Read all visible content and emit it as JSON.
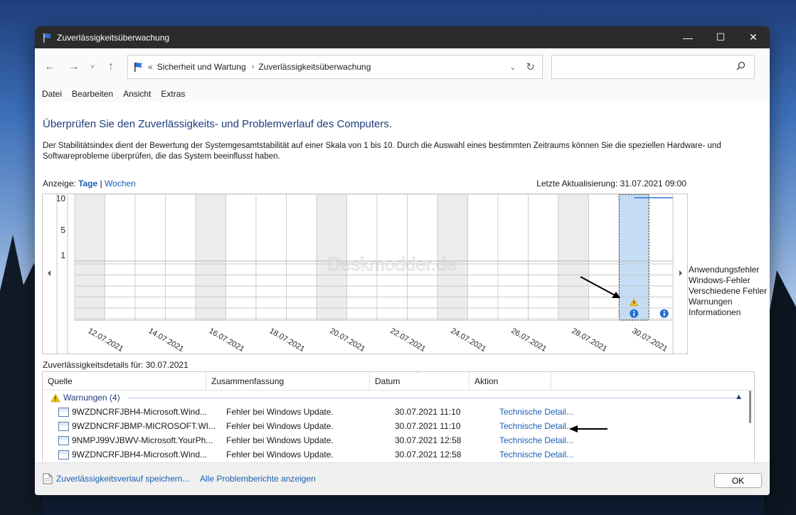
{
  "window": {
    "title": "Zuverlässigkeitsüberwachung"
  },
  "titlebar_controls": {
    "minimize": "—",
    "maximize": "☐",
    "close": "✕"
  },
  "nav": {
    "back": "←",
    "forward": "→",
    "recent": "˅",
    "up": "↑",
    "breadcrumb_prefix": "«",
    "breadcrumb": [
      "Sicherheit und Wartung",
      "Zuverlässigkeitsüberwachung"
    ],
    "breadcrumb_sep": "›",
    "search_placeholder": ""
  },
  "menu": [
    "Datei",
    "Bearbeiten",
    "Ansicht",
    "Extras"
  ],
  "heading": "Überprüfen Sie den Zuverlässigkeits- und Problemverlauf des Computers.",
  "description": "Der Stabilitätsindex dient der Bewertung der Systemgesamtstabilität auf einer Skala von 1 bis 10. Durch die Auswahl eines bestimmten Zeitraums können Sie die speziellen Hardware- und Softwareprobleme überprüfen, die das System beeinflusst haben.",
  "view": {
    "label": "Anzeige:",
    "days": "Tage",
    "separator": "|",
    "weeks": "Wochen"
  },
  "last_update": "Letzte Aktualisierung: 31.07.2021 09:00",
  "chart": {
    "y_ticks": [
      "10",
      "5",
      "1"
    ],
    "dates": [
      "12.07.2021",
      "14.07.2021",
      "16.07.2021",
      "18.07.2021",
      "20.07.2021",
      "22.07.2021",
      "24.07.2021",
      "26.07.2021",
      "28.07.2021",
      "30.07.2021"
    ],
    "days_count": 20,
    "selected_day_index": 18,
    "stability": [
      {
        "day_index": 18,
        "value": 10
      },
      {
        "day_index": 19,
        "value": 10
      }
    ],
    "events": [
      {
        "day_index": 18,
        "row": "Warnungen",
        "icon": "warning-icon"
      },
      {
        "day_index": 18,
        "row": "Informationen",
        "icon": "info-icon"
      },
      {
        "day_index": 19,
        "row": "Informationen",
        "icon": "info-icon"
      }
    ],
    "watermark": "Deskmodder.de",
    "legend": [
      "Anwendungsfehler",
      "Windows-Fehler",
      "Verschiedene Fehler",
      "Warnungen",
      "Informationen"
    ]
  },
  "details_label": "Zuverlässigkeitsdetails für: 30.07.2021",
  "table": {
    "columns": [
      "Quelle",
      "Zusammenfassung",
      "Datum",
      "Aktion"
    ],
    "group": {
      "label": "Warnungen (4)"
    },
    "rows": [
      {
        "source": "9WZDNCRFJBH4-Microsoft.Wind...",
        "summary": "Fehler bei Windows Update.",
        "date": "30.07.2021 11:10",
        "action": "Technische Detail..."
      },
      {
        "source": "9WZDNCRFJBMP-MICROSOFT.WI...",
        "summary": "Fehler bei Windows Update.",
        "date": "30.07.2021 11:10",
        "action": "Technische Detail..."
      },
      {
        "source": "9NMPJ99VJBWV-Microsoft.YourPh...",
        "summary": "Fehler bei Windows Update.",
        "date": "30.07.2021 12:58",
        "action": "Technische Detail..."
      },
      {
        "source": "9WZDNCRFJBH4-Microsoft.Wind...",
        "summary": "Fehler bei Windows Update.",
        "date": "30.07.2021 12:58",
        "action": "Technische Detail..."
      }
    ]
  },
  "footer": {
    "save_link": "Zuverlässigkeitsverlauf speichern...",
    "all_reports_link": "Alle Problemberichte anzeigen",
    "ok": "OK"
  },
  "colors": {
    "accent": "#1a5fb4",
    "heading": "#1e3c7a",
    "selection": "#c5ddf4",
    "titlebar": "#2b2b2b"
  }
}
